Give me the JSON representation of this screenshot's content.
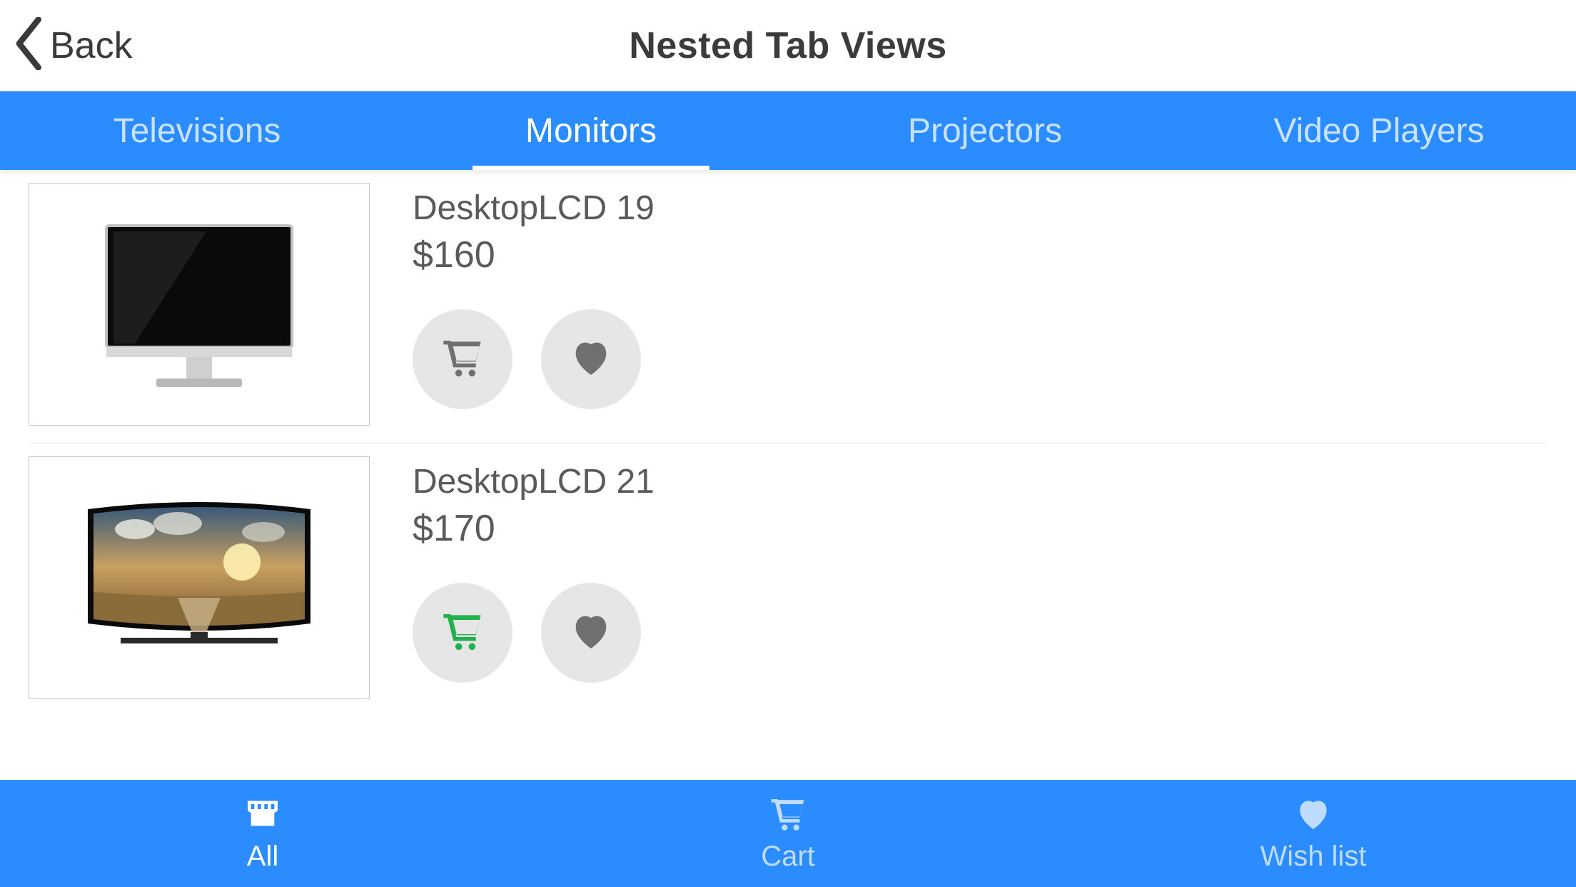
{
  "header": {
    "back_label": "Back",
    "title": "Nested Tab Views"
  },
  "category_tabs": [
    {
      "label": "Televisions",
      "active": false
    },
    {
      "label": "Monitors",
      "active": true
    },
    {
      "label": "Projectors",
      "active": false
    },
    {
      "label": "Video Players",
      "active": false
    }
  ],
  "products": [
    {
      "name": "DesktopLCD 19",
      "price": "$160",
      "cart_active": false,
      "thumb": "desktop-monitor"
    },
    {
      "name": "DesktopLCD 21",
      "price": "$170",
      "cart_active": true,
      "thumb": "curved-tv"
    }
  ],
  "bottom_tabs": [
    {
      "label": "All",
      "icon": "store",
      "active": true
    },
    {
      "label": "Cart",
      "icon": "cart",
      "active": false
    },
    {
      "label": "Wish list",
      "icon": "heart",
      "active": false
    }
  ]
}
